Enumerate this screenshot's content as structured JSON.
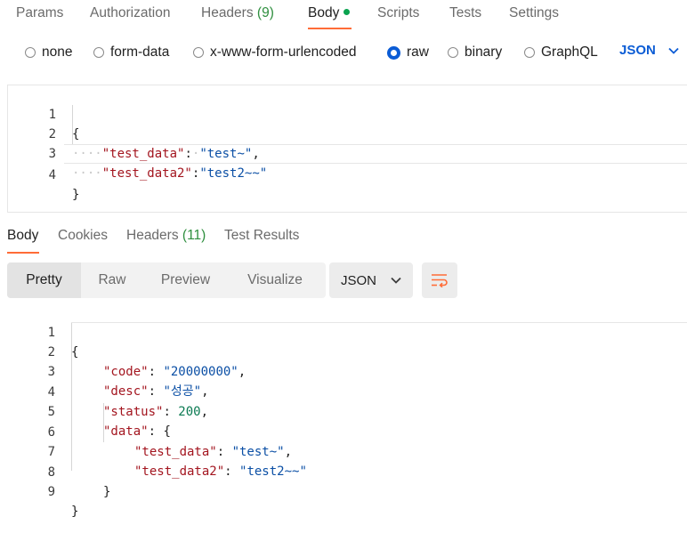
{
  "request_tabs": {
    "params": "Params",
    "authorization": "Authorization",
    "headers": "Headers",
    "headers_count": "(9)",
    "body": "Body",
    "scripts": "Scripts",
    "tests": "Tests",
    "settings": "Settings"
  },
  "body_types": {
    "none": "none",
    "form_data": "form-data",
    "urlencoded": "x-www-form-urlencoded",
    "raw": "raw",
    "binary": "binary",
    "graphql": "GraphQL",
    "selected": "raw",
    "format": "JSON"
  },
  "request_body": {
    "lines": [
      {
        "n": "1",
        "open": "{"
      },
      {
        "n": "2",
        "dots": "····",
        "key": "\"test_data\"",
        "colon": ":",
        "dot": "·",
        "val": "\"test~\"",
        "comma": ","
      },
      {
        "n": "3",
        "dots": "····",
        "key": "\"test_data2\"",
        "colon": ":",
        "val": "\"test2~~\""
      },
      {
        "n": "4",
        "close": "}"
      }
    ]
  },
  "response_tabs": {
    "body": "Body",
    "cookies": "Cookies",
    "headers": "Headers",
    "headers_count": "(11)",
    "test_results": "Test Results"
  },
  "view_modes": {
    "pretty": "Pretty",
    "raw": "Raw",
    "preview": "Preview",
    "visualize": "Visualize",
    "language": "JSON"
  },
  "response_body": {
    "lines": [
      {
        "n": "1",
        "open": "{"
      },
      {
        "n": "2",
        "key": "\"code\"",
        "colon": ": ",
        "val": "\"20000000\"",
        "comma": ","
      },
      {
        "n": "3",
        "key": "\"desc\"",
        "colon": ": ",
        "val": "\"성공\"",
        "comma": ","
      },
      {
        "n": "4",
        "key": "\"status\"",
        "colon": ": ",
        "num": "200",
        "comma": ","
      },
      {
        "n": "5",
        "key": "\"data\"",
        "colon": ": ",
        "open": "{"
      },
      {
        "n": "6",
        "key": "\"test_data\"",
        "colon": ": ",
        "val": "\"test~\"",
        "comma": ","
      },
      {
        "n": "7",
        "key": "\"test_data2\"",
        "colon": ": ",
        "val": "\"test2~~\""
      },
      {
        "n": "8",
        "close": "}"
      },
      {
        "n": "9",
        "close": "}"
      }
    ]
  },
  "colors": {
    "accent": "#ff6c37",
    "link_blue": "#0b5cd5",
    "json_key": "#a3151f",
    "json_string": "#0b4fa5",
    "json_number": "#0b7a52",
    "count_green": "#2f8f3f"
  }
}
